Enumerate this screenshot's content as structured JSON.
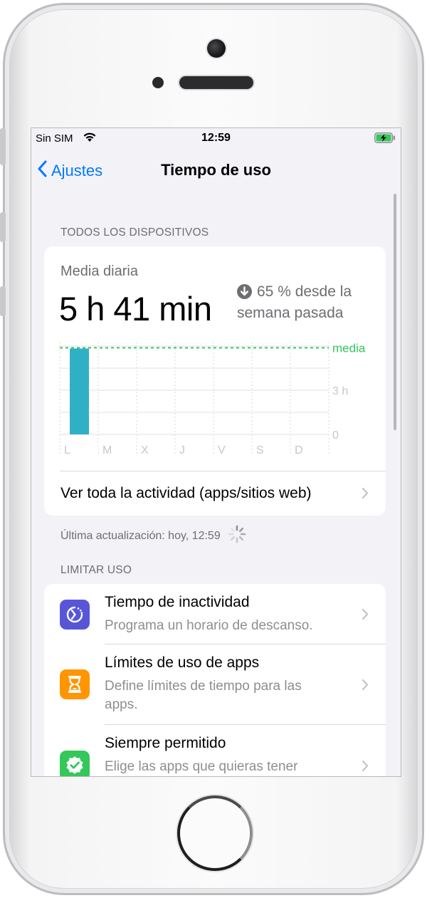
{
  "status_bar": {
    "carrier": "Sin SIM",
    "time": "12:59"
  },
  "nav": {
    "back_label": "Ajustes",
    "title": "Tiempo de uso"
  },
  "all_devices": {
    "section_title": "TODOS LOS DISPOSITIVOS",
    "daily_average_label": "Media diaria",
    "daily_average_value": "5 h 41 min",
    "change_text": "65 % desde la semana pasada",
    "chart_data": {
      "type": "bar",
      "categories": [
        "L",
        "M",
        "X",
        "J",
        "V",
        "S",
        "D"
      ],
      "values": [
        5.68,
        0,
        0,
        0,
        0,
        0,
        0
      ],
      "average_label": "media",
      "average_value": 5.68,
      "y_tick_labels": [
        "3 h",
        "0"
      ],
      "ylim": [
        0,
        6
      ],
      "bar_color": "#30b0c7",
      "average_color": "#34c759"
    },
    "see_all_label": "Ver toda la actividad (apps/sitios web)"
  },
  "last_updated": "Última actualización: hoy, 12:59",
  "limit_usage": {
    "section_title": "LIMITAR USO",
    "items": [
      {
        "title": "Tiempo de inactividad",
        "subtitle": "Programa un horario de descanso.",
        "icon": "downtime-icon",
        "color": "#5856d6"
      },
      {
        "title": "Límites de uso de apps",
        "subtitle": "Define límites de tiempo para las apps.",
        "icon": "hourglass-icon",
        "color": "#ff9500"
      },
      {
        "title": "Siempre permitido",
        "subtitle": "Elige las apps que quieras tener",
        "icon": "checkmark-badge-icon",
        "color": "#34c759"
      }
    ]
  }
}
